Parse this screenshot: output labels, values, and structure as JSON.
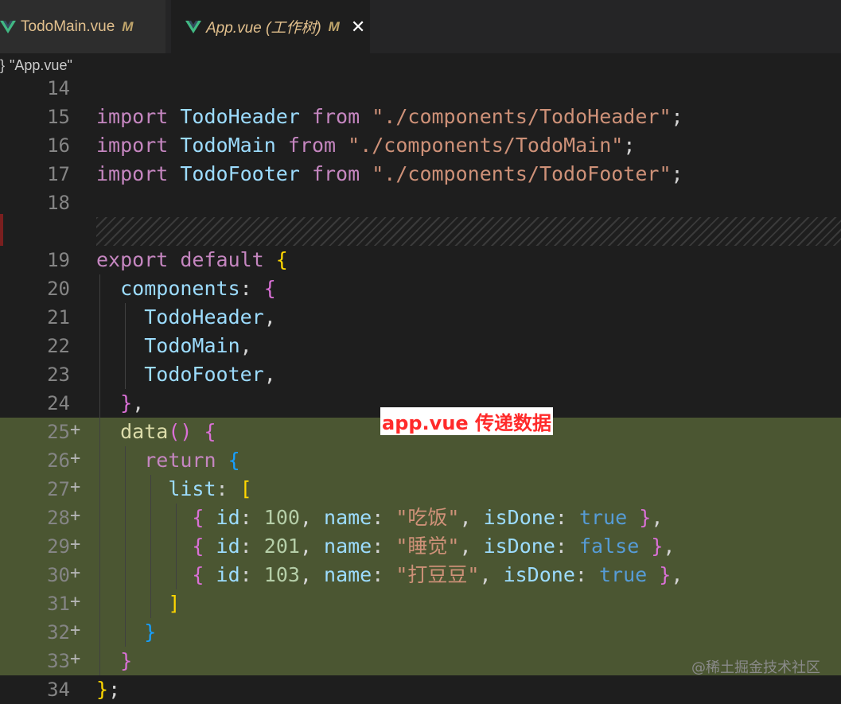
{
  "tabs": [
    {
      "label": "TodoMain.vue",
      "status": "M"
    },
    {
      "label": "App.vue (工作树)",
      "status": "M",
      "close": "✕"
    }
  ],
  "breadcrumb": {
    "brace": "}",
    "label": "\"App.vue\""
  },
  "annotation": "app.vue 传递数据",
  "watermark": "@稀土掘金技术社区",
  "lines": {
    "l14": "14",
    "l15": "15",
    "l16": "16",
    "l17": "17",
    "l18": "18",
    "l19": "19",
    "l20": "20",
    "l21": "21",
    "l22": "22",
    "l23": "23",
    "l24": "24",
    "l25": "25",
    "l26": "26",
    "l27": "27",
    "l28": "28",
    "l29": "29",
    "l30": "30",
    "l31": "31",
    "l32": "32",
    "l33": "33",
    "l34": "34"
  },
  "code": {
    "import": "import",
    "from": "from",
    "todoHeader": "TodoHeader",
    "todoMain": "TodoMain",
    "todoFooter": "TodoFooter",
    "pathHeader": "\"./components/TodoHeader\"",
    "pathMain": "\"./components/TodoMain\"",
    "pathFooter": "\"./components/TodoFooter\"",
    "export": "export",
    "default": "default",
    "components": "components",
    "data": "data",
    "return": "return",
    "list": "list",
    "id": "id",
    "name": "name",
    "isDone": "isDone",
    "id1": "100",
    "name1": "\"吃饭\"",
    "done1": "true",
    "id2": "201",
    "name2": "\"睡觉\"",
    "done2": "false",
    "id3": "103",
    "name3": "\"打豆豆\"",
    "done3": "true"
  },
  "colors": {
    "added_bg": "#4b5632",
    "annotation": "#ff2a2a"
  }
}
